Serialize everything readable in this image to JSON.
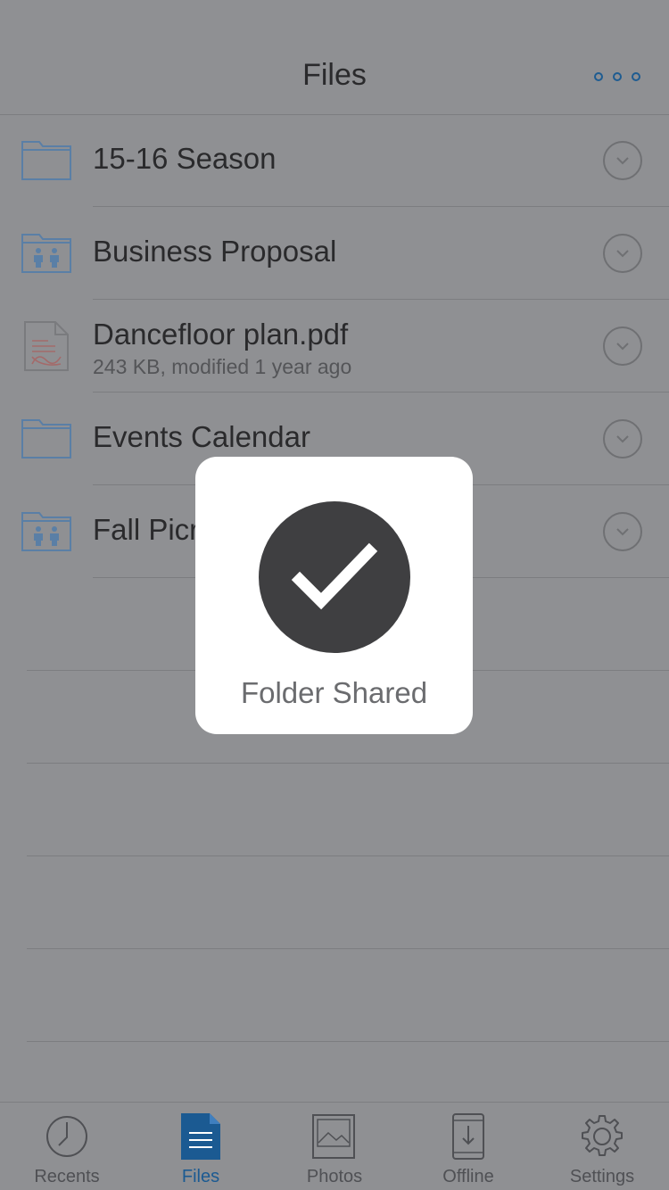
{
  "header": {
    "title": "Files"
  },
  "items": [
    {
      "name": "15-16 Season",
      "subtitle": "",
      "kind": "folder"
    },
    {
      "name": "Business Proposal",
      "subtitle": "",
      "kind": "shared-folder"
    },
    {
      "name": "Dancefloor plan.pdf",
      "subtitle": "243 KB, modified 1 year ago",
      "kind": "pdf"
    },
    {
      "name": "Events Calendar",
      "subtitle": "",
      "kind": "folder"
    },
    {
      "name": "Fall Picr",
      "subtitle": "",
      "kind": "shared-folder"
    }
  ],
  "toast": {
    "label": "Folder Shared"
  },
  "tabs": [
    {
      "label": "Recents",
      "icon": "clock-icon",
      "active": false
    },
    {
      "label": "Files",
      "icon": "document-icon",
      "active": true
    },
    {
      "label": "Photos",
      "icon": "photo-icon",
      "active": false
    },
    {
      "label": "Offline",
      "icon": "phone-download-icon",
      "active": false
    },
    {
      "label": "Settings",
      "icon": "gear-icon",
      "active": false
    }
  ],
  "colors": {
    "accent": "#1b5a92",
    "overlay_bg": "#8f9093",
    "folder_icon": "#5a7fa6",
    "pdf_icon": "#a46a6a",
    "toast_circle": "#3f3f41"
  }
}
